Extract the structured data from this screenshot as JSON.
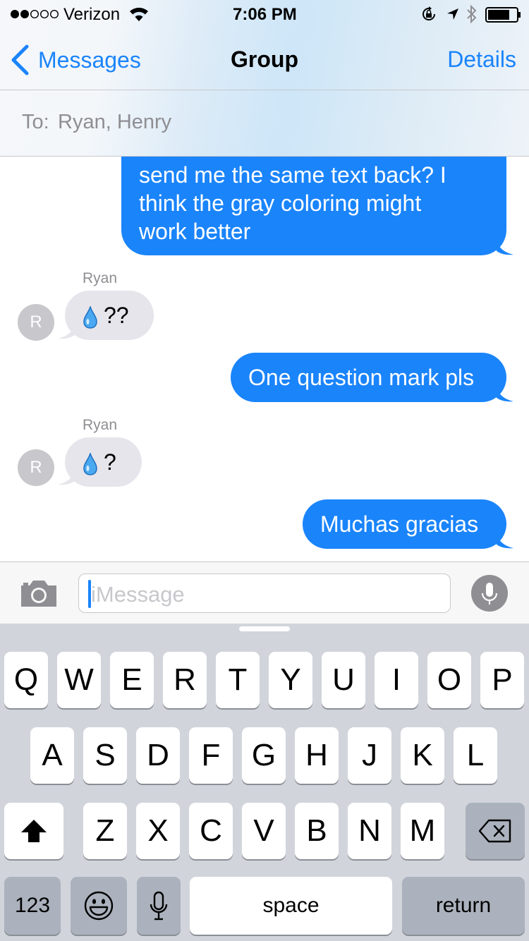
{
  "status_bar": {
    "signal_filled": 2,
    "signal_total": 5,
    "carrier": "Verizon",
    "time": "7:06 PM",
    "icons": [
      "wifi-icon",
      "rotation-lock-icon",
      "location-arrow-icon",
      "bluetooth-icon",
      "battery-icon"
    ]
  },
  "nav": {
    "back_label": "Messages",
    "title": "Group",
    "details_label": "Details"
  },
  "to_field": {
    "label": "To:",
    "recipients": "Ryan, Henry"
  },
  "messages": [
    {
      "direction": "outgoing",
      "text_lines": [
        "send me the same text back? I",
        "think the gray coloring might",
        "work better"
      ]
    },
    {
      "direction": "incoming",
      "sender": "Ryan",
      "avatar_initial": "R",
      "emoji": "droplet-icon",
      "text": "??"
    },
    {
      "direction": "outgoing",
      "text": "One question mark pls"
    },
    {
      "direction": "incoming",
      "sender": "Ryan",
      "avatar_initial": "R",
      "emoji": "droplet-icon",
      "text": "?"
    },
    {
      "direction": "outgoing",
      "text": "Muchas gracias"
    }
  ],
  "input": {
    "placeholder": "iMessage",
    "camera_icon": "camera-icon",
    "mic_icon": "microphone-icon"
  },
  "keyboard": {
    "row1": [
      "Q",
      "W",
      "E",
      "R",
      "T",
      "Y",
      "U",
      "I",
      "O",
      "P"
    ],
    "row2": [
      "A",
      "S",
      "D",
      "F",
      "G",
      "H",
      "J",
      "K",
      "L"
    ],
    "row3": [
      "Z",
      "X",
      "C",
      "V",
      "B",
      "N",
      "M"
    ],
    "numbers_label": "123",
    "space_label": "space",
    "return_label": "return",
    "shift_icon": "shift-icon",
    "delete_icon": "delete-icon",
    "emoji_icon": "emoji-icon",
    "dictation_icon": "microphone-icon"
  },
  "colors": {
    "accent": "#1a84fb",
    "incoming_bubble": "#e6e5eb",
    "keyboard_bg": "#d1d5db",
    "special_key": "#abb2bd"
  }
}
